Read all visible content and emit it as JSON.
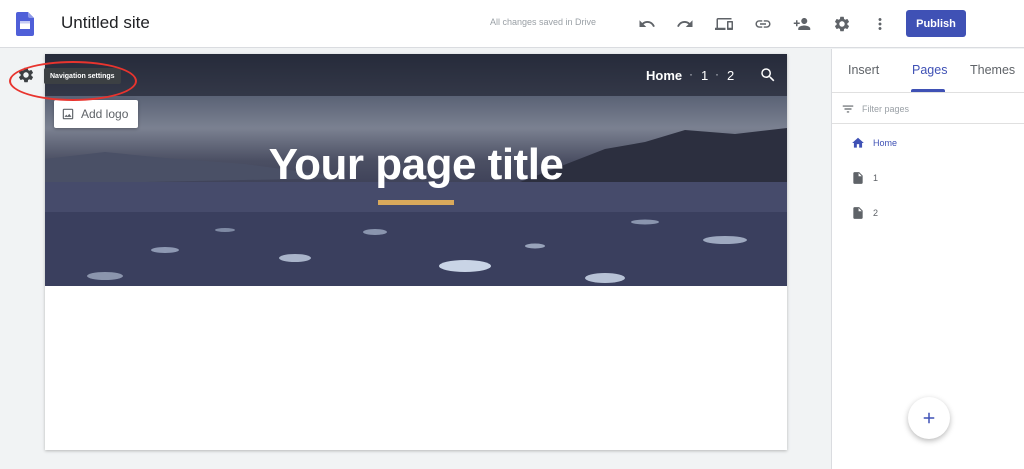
{
  "app": {
    "title": "Untitled site",
    "save_status": "All changes saved in Drive",
    "publish_label": "Publish"
  },
  "toolbar": {
    "icons": [
      "undo-icon",
      "redo-icon",
      "preview-icon",
      "link-icon",
      "add-person-icon",
      "settings-icon",
      "more-vert-icon"
    ]
  },
  "canvas": {
    "nav": {
      "home": "Home",
      "sep": "·",
      "page1": "1",
      "page2": "2"
    },
    "add_logo": "Add logo",
    "page_title": "Your page title",
    "tooltip": "Navigation settings"
  },
  "panel": {
    "tabs": [
      "Insert",
      "Pages",
      "Themes"
    ],
    "active_tab": "Pages",
    "filter_placeholder": "Filter pages",
    "pages": [
      {
        "label": "Home",
        "icon": "home-icon",
        "active": true
      },
      {
        "label": "1",
        "icon": "page-icon",
        "active": false
      },
      {
        "label": "2",
        "icon": "page-icon",
        "active": false
      }
    ]
  },
  "colors": {
    "accent": "#3f51b5",
    "highlight_ring": "#e8342e",
    "title_underline": "#d9a95b"
  }
}
